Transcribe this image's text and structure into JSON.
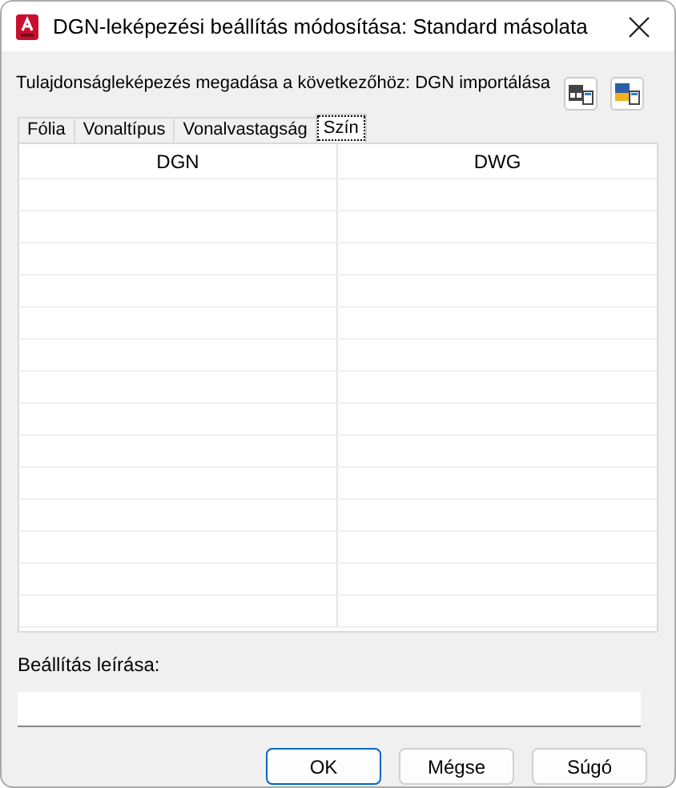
{
  "window": {
    "title": "DGN-leképezési beállítás módosítása: Standard másolata"
  },
  "intro": "Tulajdonságleképezés megadása a következőhöz: DGN importálása",
  "tabs": [
    {
      "label": "Fólia",
      "selected": false
    },
    {
      "label": "Vonaltípus",
      "selected": false
    },
    {
      "label": "Vonalvastagság",
      "selected": false
    },
    {
      "label": "Szín",
      "selected": true
    }
  ],
  "table": {
    "columns": [
      "DGN",
      "DWG"
    ]
  },
  "description": {
    "label": "Beállítás leírása:"
  },
  "buttons": [
    {
      "label": "OK",
      "default": true
    },
    {
      "label": "Mégse",
      "default": false
    },
    {
      "label": "Súgó",
      "default": false
    }
  ]
}
